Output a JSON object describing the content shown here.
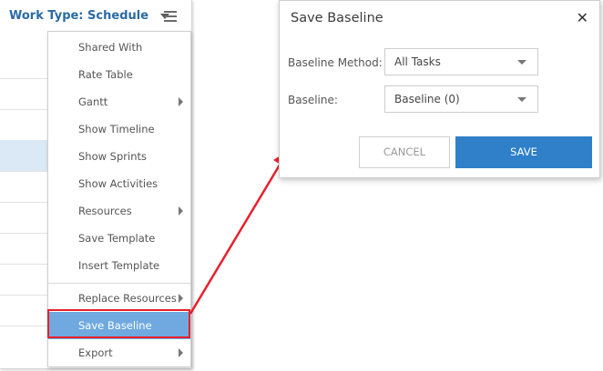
{
  "toolbar": {
    "work_type_label": "Work Type:",
    "work_type_value": "Schedule",
    "menu_icon": "hamburger-icon"
  },
  "menu": {
    "items": [
      {
        "label": "Shared With",
        "has_submenu": false
      },
      {
        "label": "Rate Table",
        "has_submenu": false
      },
      {
        "label": "Gantt",
        "has_submenu": true
      },
      {
        "label": "Show Timeline",
        "has_submenu": false
      },
      {
        "label": "Show Sprints",
        "has_submenu": false
      },
      {
        "label": "Show Activities",
        "has_submenu": false
      },
      {
        "label": "Resources",
        "has_submenu": true
      },
      {
        "label": "Save Template",
        "has_submenu": false
      },
      {
        "label": "Insert Template",
        "has_submenu": false
      },
      {
        "label": "Replace Resources",
        "has_submenu": true
      },
      {
        "label": "Save Baseline",
        "has_submenu": false,
        "active": true
      },
      {
        "label": "Export",
        "has_submenu": true
      }
    ]
  },
  "dialog": {
    "title": "Save Baseline",
    "close_icon": "close-icon",
    "baseline_method_label": "Baseline Method:",
    "baseline_method_value": "All Tasks",
    "baseline_label": "Baseline:",
    "baseline_value": "Baseline (0)",
    "cancel_label": "CANCEL",
    "save_label": "SAVE"
  },
  "colors": {
    "accent": "#2f80c8",
    "menu_active": "#6fa9df",
    "highlight_red": "#e8202a",
    "link_blue": "#2a6aa6"
  }
}
